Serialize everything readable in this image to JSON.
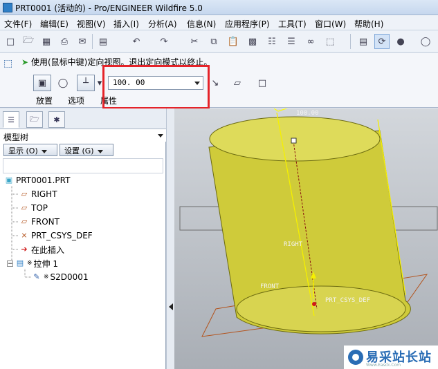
{
  "window": {
    "title": "PRT0001 (活动的) - Pro/ENGINEER Wildfire 5.0"
  },
  "menu": [
    "文件(F)",
    "编辑(E)",
    "视图(V)",
    "插入(I)",
    "分析(A)",
    "信息(N)",
    "应用程序(P)",
    "工具(T)",
    "窗口(W)",
    "帮助(H)"
  ],
  "toolbar": {
    "icons": [
      "new-file-icon",
      "open-folder-icon",
      "save-icon",
      "print-icon",
      "email-icon",
      "undo-icon",
      "redo-icon",
      "cut-icon",
      "copy-icon",
      "paste-icon",
      "paste-special-icon",
      "regenerate-icon",
      "find-icon",
      "select-box-icon",
      "datum-display-icon",
      "datum-axis-icon"
    ]
  },
  "dashboard": {
    "message": "使用(鼠标中键)定向视图。退出定向模式以终止。",
    "depth_value": "100. 00",
    "tabs": {
      "placement": "放置",
      "options": "选项",
      "properties": "属性"
    },
    "highlight_color": "#e52329"
  },
  "model_tree": {
    "title": "模型树",
    "show_button": "显示 (O)",
    "settings_button": "设置 (G)",
    "items": [
      {
        "label": "PRT0001.PRT",
        "icon": "part-icon"
      },
      {
        "label": "RIGHT",
        "icon": "datum-plane-icon"
      },
      {
        "label": "TOP",
        "icon": "datum-plane-icon"
      },
      {
        "label": "FRONT",
        "icon": "datum-plane-icon"
      },
      {
        "label": "PRT_CSYS_DEF",
        "icon": "coordinate-system-icon"
      },
      {
        "label": "在此插入",
        "icon": "insert-here-arrow-icon"
      },
      {
        "label": "拉伸 1",
        "icon": "extrude-icon",
        "prefix": "※"
      },
      {
        "label": "S2D0001",
        "icon": "sketch-icon",
        "prefix": "※"
      }
    ]
  },
  "graphics": {
    "dimension_label": "100.00",
    "datum_labels": [
      "RIGHT",
      "FRONT",
      "PRT_CSYS_DEF"
    ],
    "cylinder_color": "#d6d34a"
  },
  "watermark": {
    "text": "易采站长站",
    "sub": "Www.Easck.Com"
  }
}
